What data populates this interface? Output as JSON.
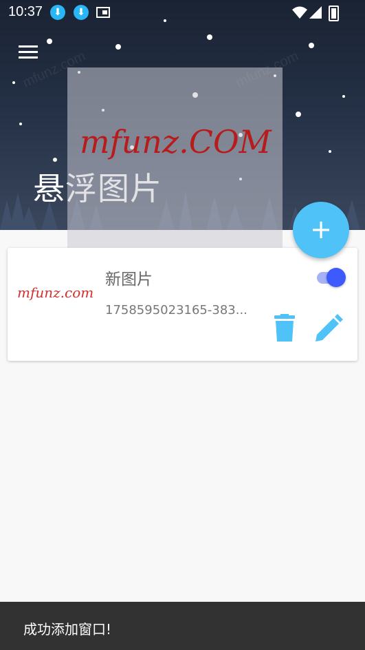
{
  "status_bar": {
    "time": "10:37"
  },
  "header": {
    "title": "悬浮图片"
  },
  "floating_image": {
    "logo_text": "mfunz.COM"
  },
  "card": {
    "title": "新图片",
    "filename": "1758595023165-383...",
    "enabled": true,
    "thumbnail_text": "mfunz.com"
  },
  "snackbar": {
    "message": "成功添加窗口!"
  },
  "colors": {
    "accent": "#4fc3f7",
    "switch_on": "#3d5afe",
    "icon_blue": "#4fc3f7",
    "logo_red": "#d32f2f"
  }
}
